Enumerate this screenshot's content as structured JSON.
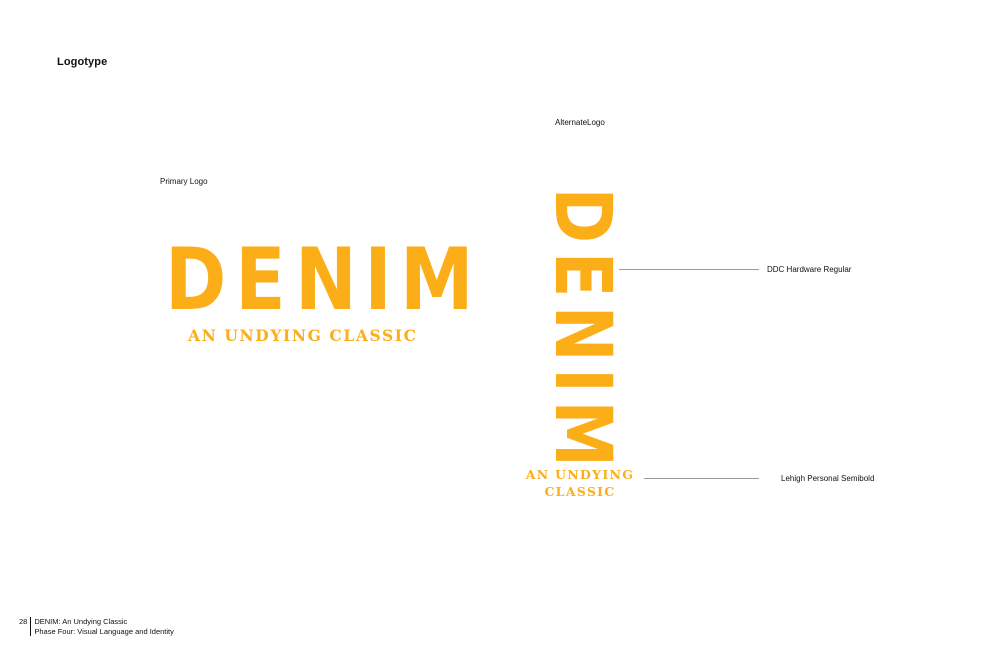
{
  "section_title": "Logotype",
  "primary": {
    "caption": "Primary Logo",
    "wordmark_letters": [
      "D",
      "E",
      "N",
      "I",
      "M"
    ],
    "tagline": "AN UNDYING CLASSIC"
  },
  "alternate": {
    "caption": "AlternateLogo",
    "wordmark_letters": [
      "D",
      "E",
      "N",
      "I",
      "M"
    ],
    "tagline_line1": "AN UNDYING",
    "tagline_line2": "CLASSIC"
  },
  "annotations": {
    "wordmark_font": "DDC Hardware Regular",
    "tagline_font": "Lehigh Personal Semibold"
  },
  "footer": {
    "page_number": "28",
    "line1": "DENIM: An Undying Classic",
    "line2": "Phase Four: Visual Language and Identity"
  },
  "colors": {
    "brand_yellow": "#fbae17",
    "leader_line": "#9a9a9a"
  }
}
